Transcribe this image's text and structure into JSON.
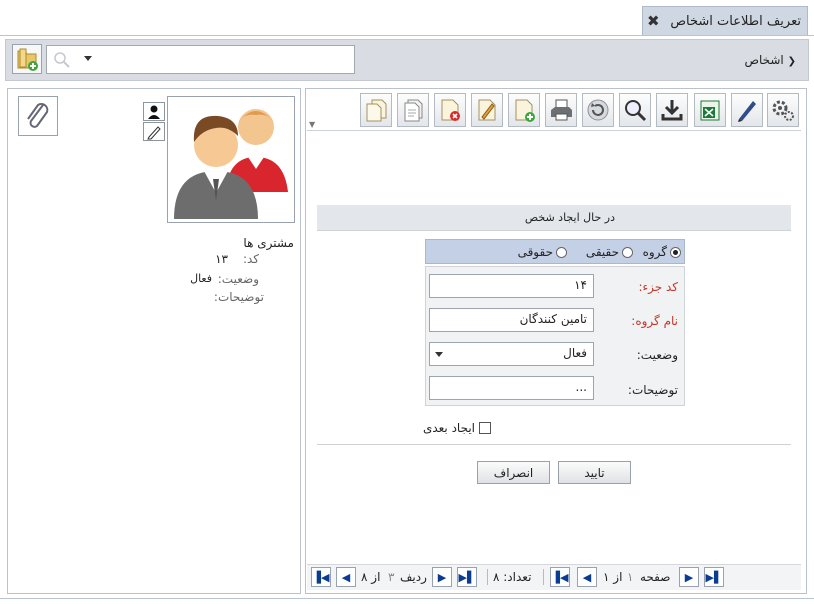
{
  "window": {
    "title": "تعریف اطلاعات اشخاص",
    "close_glyph": "✖"
  },
  "topbar": {
    "breadcrumb": "اشخاص",
    "breadcrumb_chevron": "❮",
    "search_placeholder": ""
  },
  "person": {
    "name": "مشتری ها",
    "code_label": "کد:",
    "code_value": "۱۳",
    "status_label": "وضعیت:",
    "status_value": "فعال",
    "desc_label": "توضیحات:"
  },
  "toolbar": {
    "icons": [
      "settings-icon",
      "pen-icon",
      "excel-icon",
      "download-icon",
      "search-icon",
      "refresh-icon",
      "print-icon",
      "add-document-icon",
      "edit-document-icon",
      "delete-document-icon",
      "document-icon",
      "copy-document-icon"
    ]
  },
  "form": {
    "mode_text": "در حال ایجاد شخص",
    "radio_group": "گروه",
    "radio_real": "حقیقی",
    "radio_legal": "حقوقی",
    "selected_radio": "گروه",
    "code_label": "کد جزء:",
    "code_value": "۱۴",
    "group_name_label": "نام گروه:",
    "group_name_value": "تامین کنندگان",
    "status_label": "وضعیت:",
    "status_value": "فعال",
    "desc_label": "توضیحات:",
    "desc_value": "...",
    "create_next_label": "ایجاد بعدی",
    "confirm_label": "تایید",
    "cancel_label": "انصراف"
  },
  "pager": {
    "page_label": "صفحه",
    "page_current": "۱",
    "page_of": "از ۱",
    "count_label": "تعداد: ۸",
    "row_label": "ردیف",
    "row_current": "۳",
    "row_of": "از ۸"
  },
  "colors": {
    "accent": "#c3d0e6",
    "required_label": "#c0392b",
    "pager_arrow": "#0a3d91"
  }
}
